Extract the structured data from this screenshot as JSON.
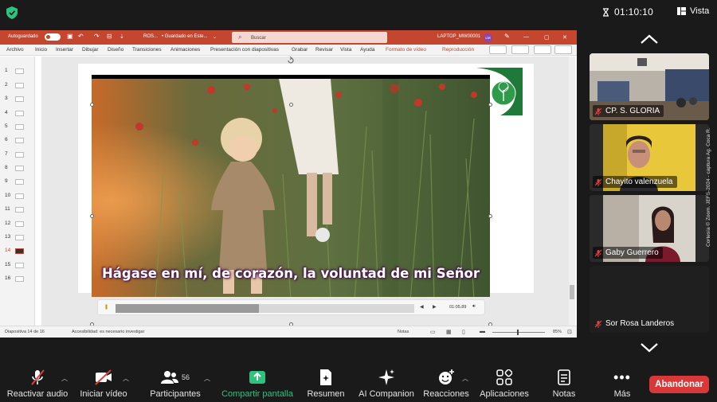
{
  "meeting": {
    "timer": "01:10:10",
    "view_label": "Vista"
  },
  "powerpoint": {
    "autosave_label": "Autoguardado",
    "file_name": "ROS...",
    "save_status": "• Guardado en Este...",
    "search_placeholder": "Buscar",
    "computer_name": "LAPTOP_MW00001",
    "user_initials": "LM",
    "menu": [
      "Archivo",
      "Inicio",
      "Insertar",
      "Dibujar",
      "Diseño",
      "Transiciones",
      "Animaciones",
      "Presentación con diapositivas",
      "Grabar",
      "Revisar",
      "Vista",
      "Ayuda",
      "Formato de vídeo",
      "Reproducción"
    ],
    "slide_numbers": [
      "1",
      "2",
      "3",
      "4",
      "5",
      "6",
      "7",
      "8",
      "9",
      "10",
      "11",
      "12",
      "13",
      "14",
      "15",
      "16"
    ],
    "active_slide": "14",
    "subtitle": "Hágase en mí, de corazón, la voluntad de mi Señor",
    "video_time": "01:05.89",
    "video_progress": 0.48,
    "status_slide": "Diapositiva 14 de 16",
    "status_accessibility": "Accesibilidad: es necesario investigar",
    "status_notes": "Notas",
    "zoom": "85%"
  },
  "participants": [
    {
      "name": "CP. S. GLORIA",
      "muted": true
    },
    {
      "name": "Chayito valenzuela",
      "muted": true
    },
    {
      "name": "Gaby Guerrero",
      "muted": true
    },
    {
      "name": "Sor Rosa Landeros",
      "muted": true
    }
  ],
  "toolbar": {
    "audio": "Reactivar audio",
    "video": "Iniciar vídeo",
    "participants": "Participantes",
    "participant_count": "56",
    "share": "Compartir pantalla",
    "summary": "Resumen",
    "companion": "AI Companion",
    "reactions": "Reacciones",
    "apps": "Aplicaciones",
    "notes": "Notas",
    "more": "Más",
    "leave": "Abandonar"
  },
  "credit": "Cortesía © Zoom. JEFS-2024 - captura Ag. Coca R.",
  "colors": {
    "ppt_accent": "#c4462f",
    "share_green": "#2ec27e",
    "leave_red": "#d93838",
    "mic_off_red": "#e04040"
  }
}
